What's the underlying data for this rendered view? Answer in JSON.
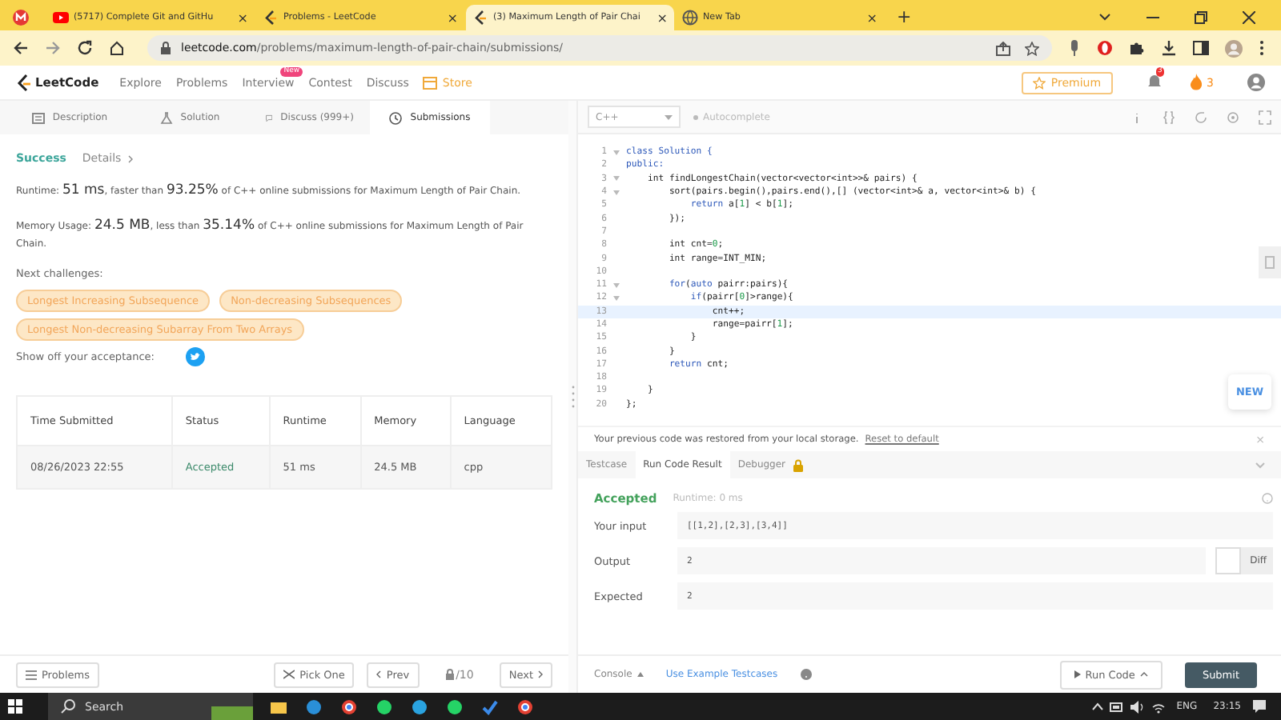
{
  "browser": {
    "tabs": [
      {
        "selected": false
      },
      {
        "title": "(5717) Complete Git and GitHu",
        "close": "×",
        "selected": false
      },
      {
        "title": "Problems - LeetCode",
        "close": "×",
        "selected": false
      },
      {
        "title": "(3) Maximum Length of Pair Chai",
        "close": "×",
        "selected": true
      },
      {
        "title": "New Tab",
        "close": "×",
        "selected": false
      }
    ],
    "new_tab": "+",
    "url_host": "leetcode.com",
    "url_path": "/problems/maximum-length-of-pair-chain/submissions/"
  },
  "nav": {
    "logo": "LeetCode",
    "items": [
      {
        "label": "Explore"
      },
      {
        "label": "Problems"
      },
      {
        "label": "Interview",
        "badge": "New"
      },
      {
        "label": "Contest"
      },
      {
        "label": "Discuss"
      }
    ],
    "store": "Store",
    "premium": "Premium",
    "notifications": "3",
    "streak": "3"
  },
  "left_tabs": [
    {
      "label": "Description",
      "selected": false
    },
    {
      "label": "Solution",
      "selected": false
    },
    {
      "label": "Discuss (999+)",
      "selected": false
    },
    {
      "label": "Submissions",
      "selected": true
    }
  ],
  "result": {
    "status": "Success",
    "details": "Details",
    "runtime": [
      {
        "text": "Runtime: ",
        "big": false
      },
      {
        "text": "51 ms",
        "big": true
      },
      {
        "text": ", faster than ",
        "big": false
      },
      {
        "text": "93.25%",
        "big": true
      },
      {
        "text": " of C++ online submissions for Maximum Length of Pair Chain.",
        "big": false
      }
    ],
    "memory": [
      {
        "text": "Memory Usage: ",
        "big": false
      },
      {
        "text": "24.5 MB",
        "big": true
      },
      {
        "text": ", less than ",
        "big": false
      },
      {
        "text": "35.14%",
        "big": true
      },
      {
        "text": " of C++ online submissions for Maximum Length of Pair Chain.",
        "big": false
      }
    ],
    "next_label": "Next challenges:",
    "challenges": [
      "Longest Increasing Subsequence",
      "Non-decreasing Subsequences",
      "Longest Non-decreasing Subarray From Two Arrays"
    ],
    "share_label": "Show off your acceptance:"
  },
  "table": {
    "columns": [
      "Time Submitted",
      "Status",
      "Runtime",
      "Memory",
      "Language"
    ],
    "rows": [
      [
        "08/26/2023 22:55",
        "Accepted",
        "51 ms",
        "24.5 MB",
        "cpp"
      ]
    ]
  },
  "editor": {
    "language": "C++",
    "autocomplete": "Autocomplete",
    "new_button": "NEW",
    "lines": [
      {
        "num": "1",
        "fold": true,
        "current": false,
        "tokens": [
          {
            "text": "class Solution {",
            "kind": "keyword"
          }
        ]
      },
      {
        "num": "2",
        "fold": false,
        "current": false,
        "tokens": [
          {
            "text": "public:",
            "kind": "keyword"
          }
        ]
      },
      {
        "num": "3",
        "fold": true,
        "current": false,
        "tokens": [
          {
            "text": "    int findLongestChain(vector<vector<int>>& pairs) {",
            "kind": "plain"
          }
        ]
      },
      {
        "num": "4",
        "fold": true,
        "current": false,
        "tokens": [
          {
            "text": "        sort(pairs.begin(),pairs.end(),[] (vector<int>& a, vector<int>& b) {",
            "kind": "plain"
          }
        ]
      },
      {
        "num": "5",
        "fold": false,
        "current": false,
        "tokens": [
          {
            "text": "            return",
            "kind": "keyword"
          },
          {
            "text": " a[",
            "kind": "plain"
          },
          {
            "text": "1",
            "kind": "number"
          },
          {
            "text": "] < b[",
            "kind": "plain"
          },
          {
            "text": "1",
            "kind": "number"
          },
          {
            "text": "];",
            "kind": "plain"
          }
        ]
      },
      {
        "num": "6",
        "fold": false,
        "current": false,
        "tokens": [
          {
            "text": "        });",
            "kind": "plain"
          }
        ]
      },
      {
        "num": "7",
        "fold": false,
        "current": false
      },
      {
        "num": "8",
        "fold": false,
        "current": false,
        "tokens": [
          {
            "text": "        int cnt=",
            "kind": "plain"
          },
          {
            "text": "0",
            "kind": "number"
          },
          {
            "text": ";",
            "kind": "plain"
          }
        ]
      },
      {
        "num": "9",
        "fold": false,
        "current": false,
        "tokens": [
          {
            "text": "        int range=INT_MIN;",
            "kind": "plain"
          }
        ]
      },
      {
        "num": "10",
        "fold": false,
        "current": false
      },
      {
        "num": "11",
        "fold": true,
        "current": false,
        "tokens": [
          {
            "text": "        for",
            "kind": "keyword"
          },
          {
            "text": "(",
            "kind": "plain"
          },
          {
            "text": "auto",
            "kind": "keyword"
          },
          {
            "text": " pairr:pairs){",
            "kind": "plain"
          }
        ]
      },
      {
        "num": "12",
        "fold": true,
        "current": false,
        "tokens": [
          {
            "text": "            if",
            "kind": "keyword"
          },
          {
            "text": "(pairr[",
            "kind": "plain"
          },
          {
            "text": "0",
            "kind": "number"
          },
          {
            "text": "]>range){",
            "kind": "plain"
          }
        ]
      },
      {
        "num": "13",
        "fold": false,
        "current": true,
        "tokens": [
          {
            "text": "                cnt++;",
            "kind": "plain"
          }
        ]
      },
      {
        "num": "14",
        "fold": false,
        "current": false,
        "tokens": [
          {
            "text": "                range=pairr[",
            "kind": "plain"
          },
          {
            "text": "1",
            "kind": "number"
          },
          {
            "text": "];",
            "kind": "plain"
          }
        ]
      },
      {
        "num": "15",
        "fold": false,
        "current": false,
        "tokens": [
          {
            "text": "            }",
            "kind": "plain"
          }
        ]
      },
      {
        "num": "16",
        "fold": false,
        "current": false,
        "tokens": [
          {
            "text": "        }",
            "kind": "plain"
          }
        ]
      },
      {
        "num": "17",
        "fold": false,
        "current": false,
        "tokens": [
          {
            "text": "        return",
            "kind": "keyword"
          },
          {
            "text": " cnt;",
            "kind": "plain"
          }
        ]
      },
      {
        "num": "18",
        "fold": false,
        "current": false
      },
      {
        "num": "19",
        "fold": false,
        "current": false,
        "tokens": [
          {
            "text": "    }",
            "kind": "plain"
          }
        ]
      },
      {
        "num": "20",
        "fold": false,
        "current": false,
        "tokens": [
          {
            "text": "};",
            "kind": "plain"
          }
        ]
      }
    ],
    "restore_message": "Your previous code was restored from your local storage.",
    "reset_link": "Reset to default",
    "close": "×"
  },
  "console_tabs": [
    {
      "label": "Testcase",
      "selected": false,
      "locked": false
    },
    {
      "label": "Run Code Result",
      "selected": true,
      "locked": false
    },
    {
      "label": "Debugger",
      "selected": false,
      "locked": true
    }
  ],
  "run_result": {
    "status": "Accepted",
    "runtime": "Runtime: 0 ms",
    "fields": [
      {
        "label": "Your input",
        "value": "[[1,2],[2,3],[3,4]]"
      },
      {
        "label": "Output",
        "value": "2"
      },
      {
        "label": "Expected",
        "value": "2"
      }
    ],
    "diff": "Diff"
  },
  "bottom_left": {
    "problems": "Problems",
    "pick_one": "Pick One",
    "prev": "Prev",
    "page": "/10",
    "next": "Next"
  },
  "bottom_right": {
    "console": "Console",
    "example": "Use Example Testcases",
    "run": "Run Code",
    "submit": "Submit"
  },
  "taskbar": {
    "search": "Search",
    "language": "ENG",
    "time": "23:15"
  }
}
